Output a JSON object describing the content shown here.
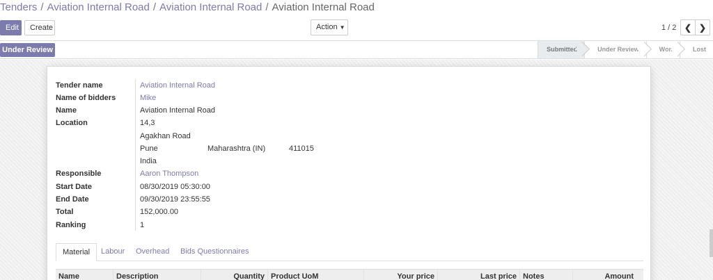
{
  "breadcrumb": {
    "items": [
      "Tenders",
      "Aviation Internal Road",
      "Aviation Internal Road"
    ],
    "current": "Aviation Internal Road",
    "separator": "/"
  },
  "toolbar": {
    "edit_label": "Edit",
    "create_label": "Create",
    "action_label": "Action",
    "pager": "1 / 2"
  },
  "statusbar": {
    "button_label": "Under Review",
    "stages": [
      {
        "label": "Submitted",
        "active": true
      },
      {
        "label": "Under Review",
        "active": false
      },
      {
        "label": "Won",
        "active": false
      },
      {
        "label": "Lost",
        "active": false
      }
    ]
  },
  "form": {
    "tender_name_label": "Tender name",
    "tender_name": "Aviation Internal Road",
    "bidders_label": "Name of bidders",
    "bidders": "Mike",
    "name_label": "Name",
    "name": "Aviation Internal Road",
    "location_label": "Location",
    "location": {
      "street": "14,3",
      "street2": "Agakhan Road",
      "city": "Pune",
      "state": "Maharashtra (IN)",
      "zip": "411015",
      "country": "India"
    },
    "responsible_label": "Responsible",
    "responsible": "Aaron Thompson",
    "start_date_label": "Start Date",
    "start_date": "08/30/2019 05:30:00",
    "end_date_label": "End Date",
    "end_date": "09/30/2019 23:55:55",
    "total_label": "Total",
    "total": "152,000.00",
    "ranking_label": "Ranking",
    "ranking": "1"
  },
  "tabs": [
    "Material",
    "Labour",
    "Overhead",
    "Bids Questionnaires"
  ],
  "table": {
    "columns": [
      "Name",
      "Description",
      "Quantity",
      "Product UoM",
      "Your price",
      "Last price",
      "Notes",
      "Amount"
    ]
  },
  "colors": {
    "accent": "#7c7bad",
    "stage_active_bg": "#e9ecef"
  }
}
